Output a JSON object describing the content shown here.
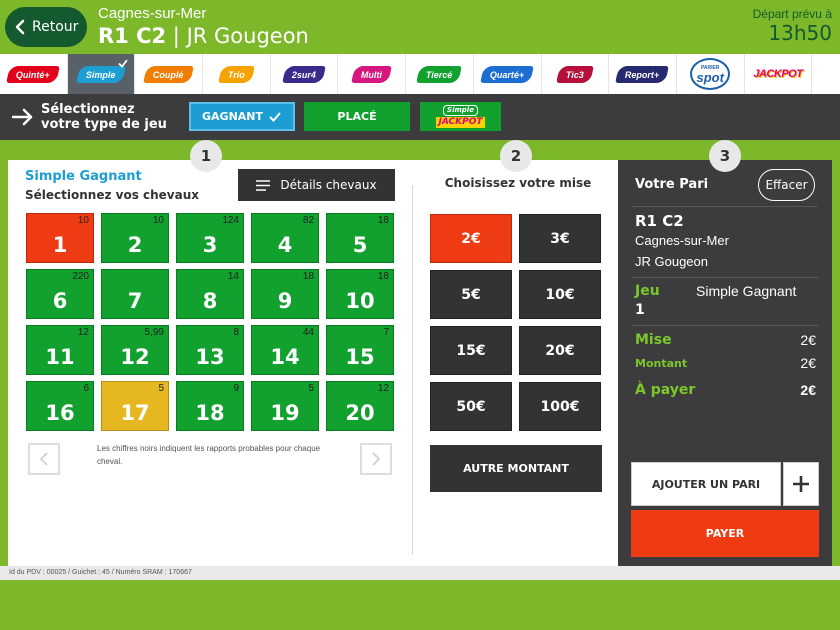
{
  "header": {
    "back_label": "Retour",
    "venue": "Cagnes-sur-Mer",
    "race_code": "R1 C2",
    "race_separator": " | ",
    "race_name": "JR Gougeon",
    "departure_label": "Départ prévu à",
    "departure_time": "13h50"
  },
  "tabs": [
    {
      "label": "Quinté+",
      "color": "#e3001b"
    },
    {
      "label": "Simple",
      "color": "#1c9ed3",
      "active": true
    },
    {
      "label": "Couplé",
      "color": "#f07d00"
    },
    {
      "label": "Trio",
      "color": "#f5a300"
    },
    {
      "label": "2sur4",
      "color": "#3a2a8c"
    },
    {
      "label": "Multi",
      "color": "#d6177f"
    },
    {
      "label": "Tiercé",
      "color": "#12a02e"
    },
    {
      "label": "Quarté+",
      "color": "#1c6fd1"
    },
    {
      "label": "Tic3",
      "color": "#b5103b"
    },
    {
      "label": "Report+",
      "color": "#262a6e"
    },
    {
      "label": "spot",
      "color": "#1d5fa8",
      "logo": "spot"
    },
    {
      "label": "JACKPOT",
      "color": "#e6007e",
      "logo": "jackpot"
    }
  ],
  "spot_logo_small": "PARIER",
  "type_bar": {
    "label_line1": "Sélectionnez",
    "label_line2": "votre type de jeu",
    "gagnant": "GAGNANT",
    "place": "PLACÉ",
    "simple_jackpot_top": "Simple",
    "simple_jackpot_bottom": "JACKPOT"
  },
  "steps": [
    "1",
    "2",
    "3"
  ],
  "section1": {
    "title": "Simple Gagnant",
    "subtitle": "Sélectionnez vos chevaux",
    "details_label": "Détails chevaux",
    "legend": "Les chiffres noirs indiquent les rapports probables pour chaque cheval."
  },
  "horses": [
    {
      "num": "1",
      "odds": "10",
      "state": "red"
    },
    {
      "num": "2",
      "odds": "10",
      "state": "green"
    },
    {
      "num": "3",
      "odds": "124",
      "state": "green"
    },
    {
      "num": "4",
      "odds": "82",
      "state": "green"
    },
    {
      "num": "5",
      "odds": "18",
      "state": "green"
    },
    {
      "num": "6",
      "odds": "220",
      "state": "green"
    },
    {
      "num": "7",
      "odds": "",
      "state": "green"
    },
    {
      "num": "8",
      "odds": "14",
      "state": "green"
    },
    {
      "num": "9",
      "odds": "18",
      "state": "green"
    },
    {
      "num": "10",
      "odds": "18",
      "state": "green"
    },
    {
      "num": "11",
      "odds": "12",
      "state": "green"
    },
    {
      "num": "12",
      "odds": "5,99",
      "state": "green"
    },
    {
      "num": "13",
      "odds": "8",
      "state": "green"
    },
    {
      "num": "14",
      "odds": "44",
      "state": "green"
    },
    {
      "num": "15",
      "odds": "7",
      "state": "green"
    },
    {
      "num": "16",
      "odds": "6",
      "state": "green"
    },
    {
      "num": "17",
      "odds": "5",
      "state": "yellow"
    },
    {
      "num": "18",
      "odds": "9",
      "state": "green"
    },
    {
      "num": "19",
      "odds": "5",
      "state": "green"
    },
    {
      "num": "20",
      "odds": "12",
      "state": "green"
    }
  ],
  "section2": {
    "title": "Choisissez votre mise",
    "amounts": [
      {
        "label": "2€",
        "selected": true
      },
      {
        "label": "3€",
        "selected": false
      },
      {
        "label": "5€",
        "selected": false
      },
      {
        "label": "10€",
        "selected": false
      },
      {
        "label": "15€",
        "selected": false
      },
      {
        "label": "20€",
        "selected": false
      },
      {
        "label": "50€",
        "selected": false
      },
      {
        "label": "100€",
        "selected": false
      }
    ],
    "other_amount": "AUTRE MONTANT"
  },
  "slip": {
    "title": "Votre Pari",
    "clear_label": "Effacer",
    "race_code": "R1 C2",
    "venue": "Cagnes-sur-Mer",
    "course": "JR Gougeon",
    "jeu_label": "Jeu",
    "jeu_value": "Simple Gagnant",
    "horse": "1",
    "mise_label": "Mise",
    "mise_value": "2€",
    "montant_label": "Montant",
    "montant_value": "2€",
    "payer_label": "À payer",
    "payer_value": "2€",
    "add_label": "AJOUTER UN PARI",
    "pay_button": "PAYER"
  },
  "footer": {
    "id_text": "Id du PDV : 00025 / Guichet : 45 / Numéro SRAM : 170667"
  },
  "colors": {
    "brand_green": "#7cb829",
    "dark_green": "#145a2e",
    "horse_green": "#12a02e",
    "selected_red": "#ee3b13",
    "favorite_yellow": "#e5b822",
    "accent_blue": "#1c9ed3",
    "dark_panel": "#3c3c3e"
  }
}
